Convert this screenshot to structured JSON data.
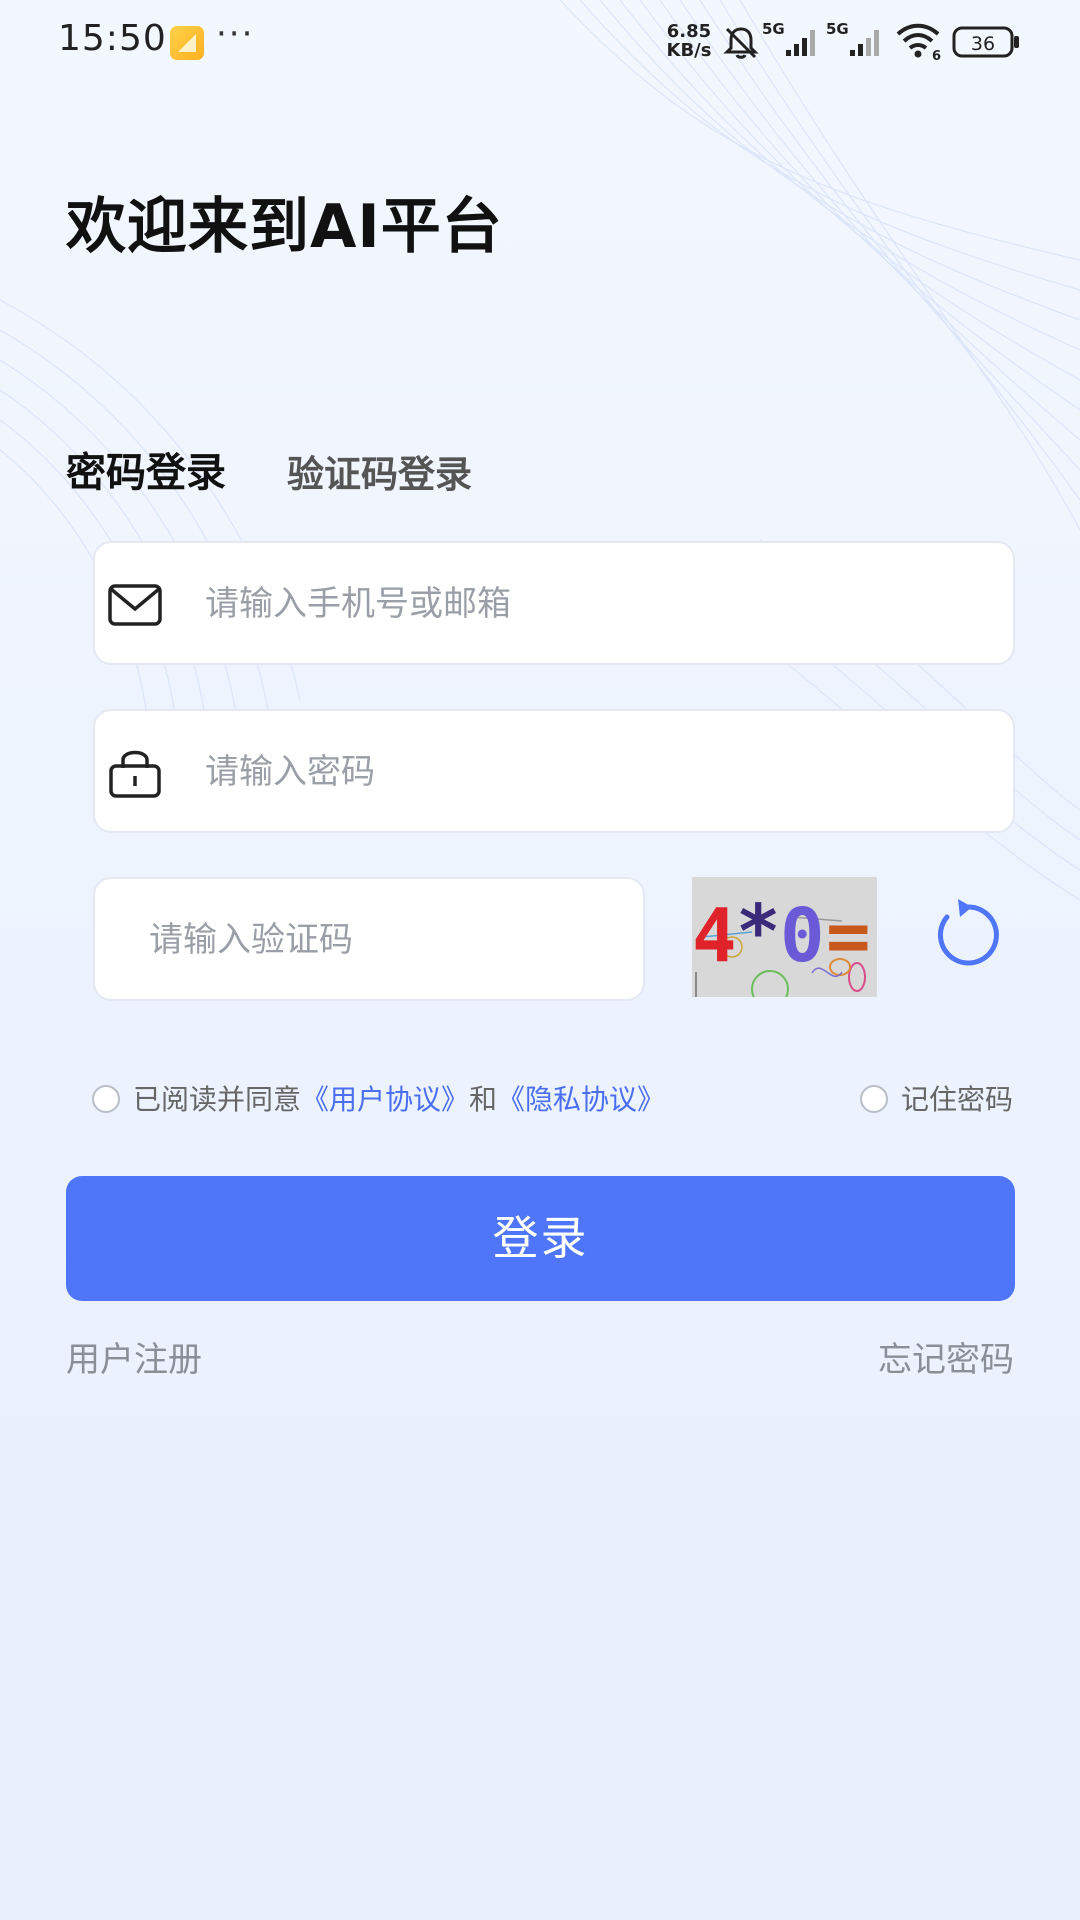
{
  "status_bar": {
    "time": "15:50",
    "network_speed_value": "6.85",
    "network_speed_unit": "KB/s",
    "signal_1": "5G",
    "signal_2": "5G",
    "wifi_badge": "6",
    "battery": "36",
    "more": "···"
  },
  "title": "欢迎来到AI平台",
  "tabs": [
    {
      "label": "密码登录",
      "active": true
    },
    {
      "label": "验证码登录",
      "active": false
    }
  ],
  "form": {
    "account_placeholder": "请输入手机号或邮箱",
    "password_placeholder": "请输入密码",
    "captcha_placeholder": "请输入验证码",
    "captcha_image_text": [
      "4",
      "*",
      "0",
      "="
    ]
  },
  "agreement": {
    "prefix": "已阅读并同意",
    "user_agreement": "《用户协议》",
    "and": "和",
    "privacy_agreement": "《隐私协议》",
    "remember_password": "记住密码"
  },
  "login_button": "登录",
  "links": {
    "register": "用户注册",
    "forgot_password": "忘记密码"
  },
  "colors": {
    "primary": "#4f76f9",
    "link": "#4a6ff0",
    "refresh_icon": "#4f76f9"
  }
}
